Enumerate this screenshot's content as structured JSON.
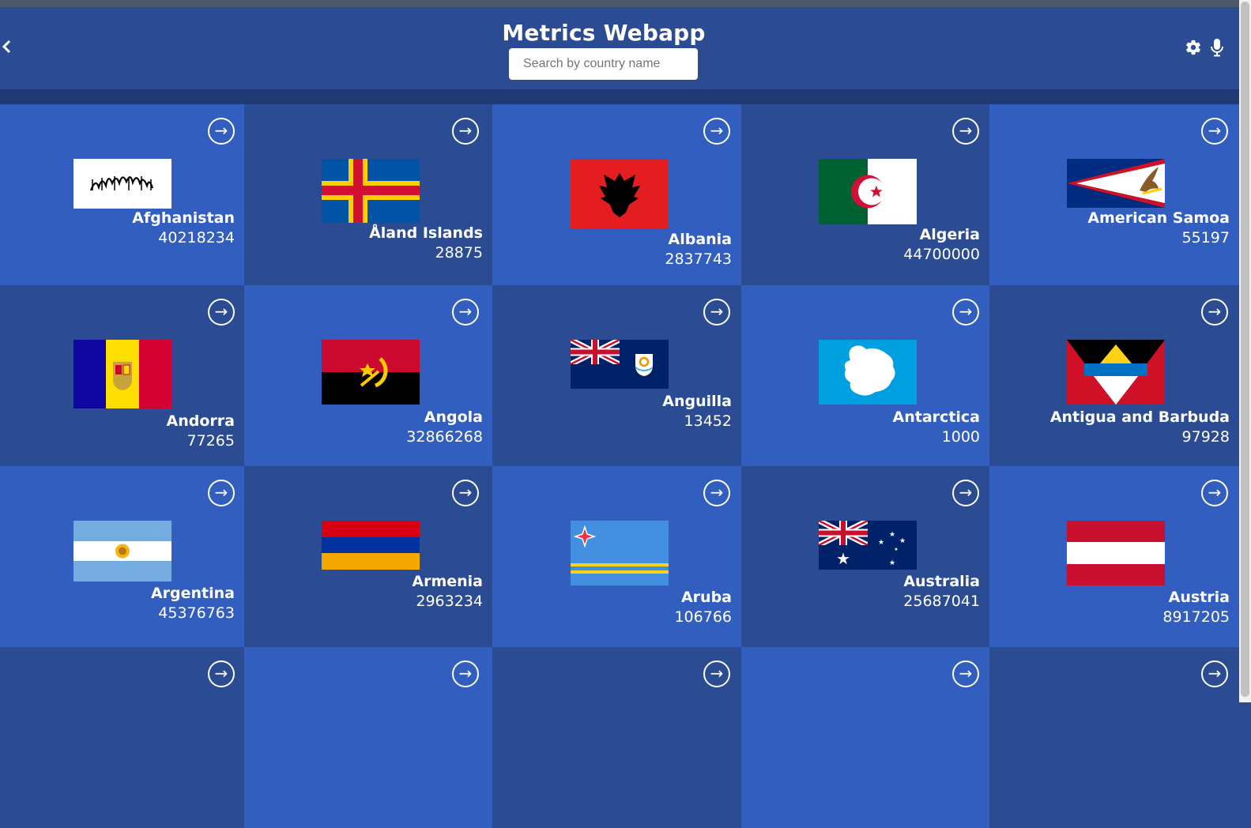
{
  "header": {
    "title": "Metrics Webapp",
    "search_placeholder": "Search by country name"
  },
  "icons": {
    "back": "chevron-left-icon",
    "settings": "gear-icon",
    "microphone": "microphone-icon",
    "card_open": "arrow-right-circle-icon"
  },
  "colors": {
    "header_bg": "#2b4c93",
    "card_dark": "#2b4c93",
    "card_light": "#325fbf",
    "text": "#ffffff"
  },
  "countries": [
    {
      "name": "Afghanistan",
      "population": "40218234"
    },
    {
      "name": "Åland Islands",
      "population": "28875"
    },
    {
      "name": "Albania",
      "population": "2837743"
    },
    {
      "name": "Algeria",
      "population": "44700000"
    },
    {
      "name": "American Samoa",
      "population": "55197"
    },
    {
      "name": "Andorra",
      "population": "77265"
    },
    {
      "name": "Angola",
      "population": "32866268"
    },
    {
      "name": "Anguilla",
      "population": "13452"
    },
    {
      "name": "Antarctica",
      "population": "1000"
    },
    {
      "name": "Antigua and Barbuda",
      "population": "97928"
    },
    {
      "name": "Argentina",
      "population": "45376763"
    },
    {
      "name": "Armenia",
      "population": "2963234"
    },
    {
      "name": "Aruba",
      "population": "106766"
    },
    {
      "name": "Australia",
      "population": "25687041"
    },
    {
      "name": "Austria",
      "population": "8917205"
    }
  ]
}
